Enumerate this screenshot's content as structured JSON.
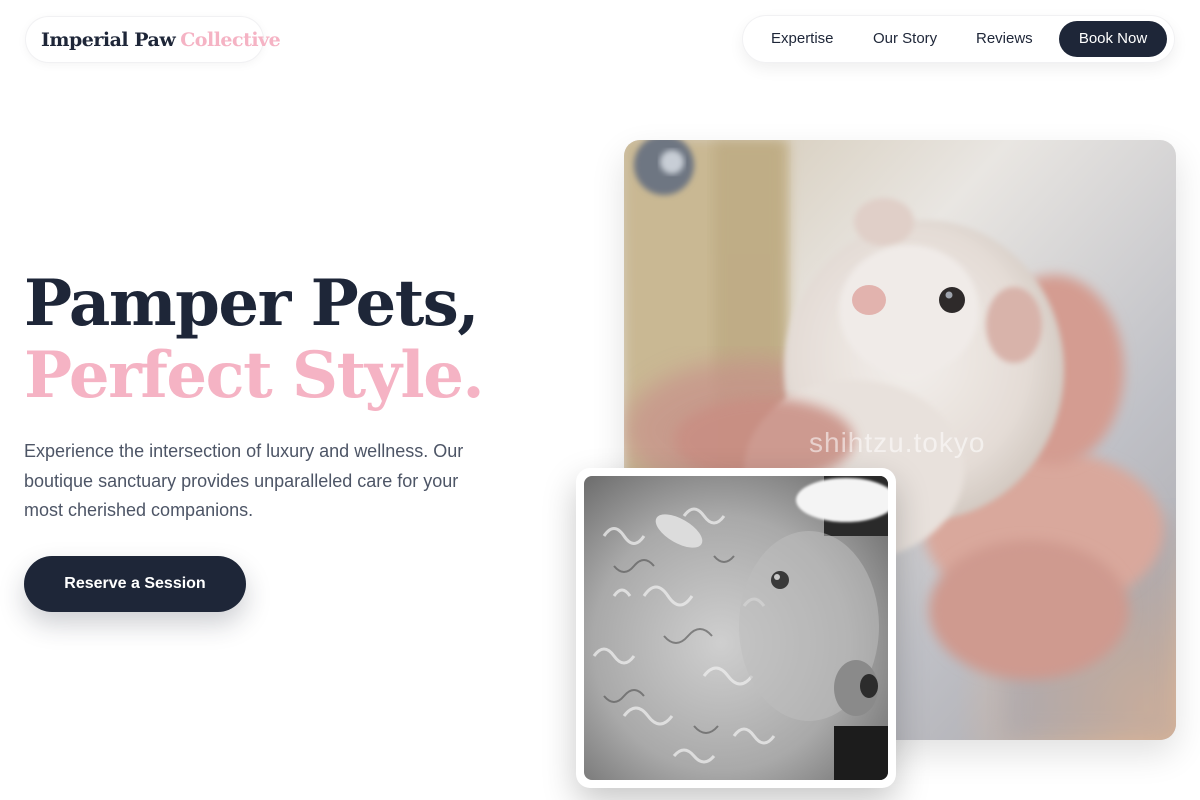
{
  "logo": {
    "part1": "Imperial Paw",
    "part2": "Collective"
  },
  "nav": {
    "items": [
      "Expertise",
      "Our Story",
      "Reviews"
    ],
    "book_label": "Book Now"
  },
  "hero": {
    "line1": "Pamper Pets,",
    "line2": "Perfect Style.",
    "subtitle": "Experience the intersection of luxury and wellness. Our boutique sanctuary provides unparalleled care for your most cherished companions.",
    "cta_label": "Reserve a Session"
  },
  "photos": {
    "main_watermark": "shihtzu.tokyo"
  },
  "colors": {
    "navy": "#1e2638",
    "pink": "#f5b3c4",
    "body_text": "#4d5566"
  }
}
